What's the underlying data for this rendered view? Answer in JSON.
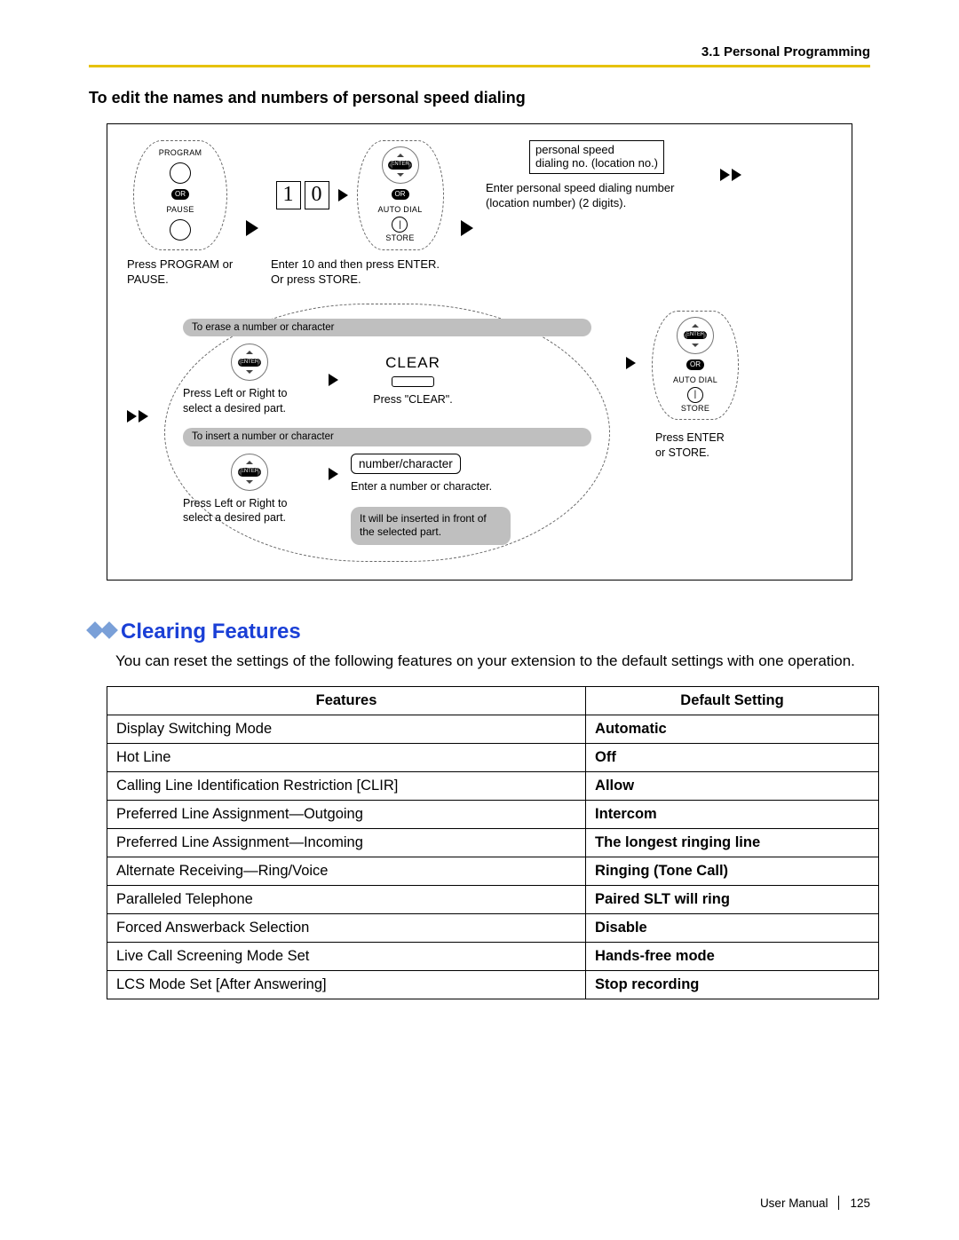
{
  "header": {
    "section_number": "3.1 Personal Programming"
  },
  "section_title": "To edit the names and numbers of personal speed dialing",
  "diagram": {
    "step1": {
      "program_label": "PROGRAM",
      "or_label": "OR",
      "pause_label": "PAUSE",
      "caption": "Press PROGRAM or PAUSE."
    },
    "step2": {
      "digits": [
        "1",
        "0"
      ],
      "enter_label": "ENTER",
      "or_label": "OR",
      "autodial_label": "AUTO DIAL",
      "store_label": "STORE",
      "caption": "Enter 10 and then press ENTER. Or press STORE."
    },
    "step3": {
      "value_line1": "personal speed",
      "value_line2": "dialing no. (location no.)",
      "caption": "Enter personal speed dialing number (location number) (2 digits)."
    },
    "erase_hdr": "To erase a number or character",
    "insert_hdr": "To insert a number or character",
    "navpad_enter": "ENTER",
    "erase": {
      "nav_caption": "Press Left or Right to select a desired part.",
      "clear_label": "CLEAR",
      "clear_caption": "Press \"CLEAR\"."
    },
    "insert": {
      "nav_caption": "Press Left or Right to select a desired part.",
      "value": "number/character",
      "value_caption": "Enter a number or character.",
      "balloon": "It will be inserted in front of the selected part."
    },
    "right_enter": {
      "enter_label": "ENTER",
      "or_label": "OR",
      "autodial_label": "AUTO DIAL",
      "store_label": "STORE",
      "caption": "Press ENTER or STORE."
    }
  },
  "clearing": {
    "heading": "Clearing Features",
    "desc": "You can reset the settings of the following features on your extension to the default settings with one operation.",
    "col_features": "Features",
    "col_default": "Default Setting",
    "rows": [
      {
        "feature": "Display Switching Mode",
        "def": "Automatic"
      },
      {
        "feature": "Hot Line",
        "def": "Off"
      },
      {
        "feature": "Calling Line Identification Restriction [CLIR]",
        "def": "Allow"
      },
      {
        "feature": "Preferred Line Assignment—Outgoing",
        "def": "Intercom"
      },
      {
        "feature": "Preferred Line Assignment—Incoming",
        "def": "The longest ringing line"
      },
      {
        "feature": "Alternate Receiving—Ring/Voice",
        "def": "Ringing (Tone Call)"
      },
      {
        "feature": "Paralleled Telephone",
        "def": "Paired SLT will ring"
      },
      {
        "feature": "Forced Answerback Selection",
        "def": "Disable"
      },
      {
        "feature": "Live Call Screening Mode Set",
        "def": "Hands-free mode"
      },
      {
        "feature": "LCS Mode Set [After Answering]",
        "def": "Stop recording"
      }
    ]
  },
  "footer": {
    "manual": "User Manual",
    "page": "125"
  }
}
